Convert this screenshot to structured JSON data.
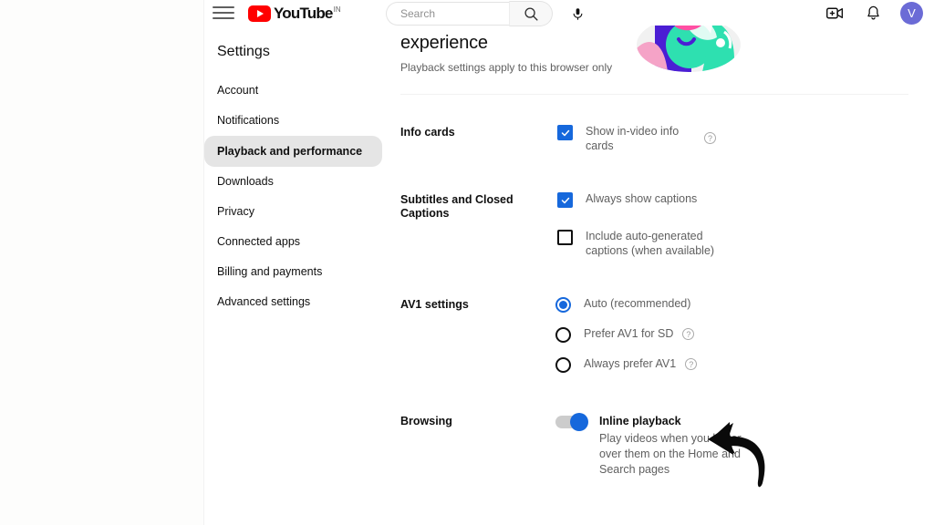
{
  "masthead": {
    "menu_icon": "hamburger-icon",
    "logo_text": "YouTube",
    "logo_country": "IN",
    "search_placeholder": "Search",
    "search_value": "",
    "search_icon": "search-icon",
    "mic_icon": "microphone-icon",
    "create_icon": "create-video-icon",
    "notifications_icon": "bell-icon",
    "avatar_letter": "V"
  },
  "sidebar": {
    "title": "Settings",
    "items": [
      {
        "label": "Account",
        "active": false
      },
      {
        "label": "Notifications",
        "active": false
      },
      {
        "label": "Playback and performance",
        "active": true
      },
      {
        "label": "Downloads",
        "active": false
      },
      {
        "label": "Privacy",
        "active": false
      },
      {
        "label": "Connected apps",
        "active": false
      },
      {
        "label": "Billing and payments",
        "active": false
      },
      {
        "label": "Advanced settings",
        "active": false
      }
    ]
  },
  "main": {
    "title": "experience",
    "subtitle": "Playback settings apply to this browser only",
    "sections": {
      "info_cards": {
        "label": "Info cards",
        "option_label": "Show in-video info cards",
        "checked": true,
        "help_icon": "help-circle-icon"
      },
      "subtitles": {
        "label": "Subtitles and Closed Captions",
        "option1_label": "Always show captions",
        "option1_checked": true,
        "option2_label": "Include auto-generated captions (when available)",
        "option2_checked": false
      },
      "av1": {
        "label": "AV1 settings",
        "options": [
          {
            "label": "Auto (recommended)",
            "selected": true,
            "help": false
          },
          {
            "label": "Prefer AV1 for SD",
            "selected": false,
            "help": true
          },
          {
            "label": "Always prefer AV1",
            "selected": false,
            "help": true
          }
        ]
      },
      "browsing": {
        "label": "Browsing",
        "toggle_label": "Inline playback",
        "toggle_on": true,
        "toggle_description": "Play videos when you hover over them on the Home and Search pages"
      }
    }
  },
  "annotation": {
    "arrow": "curved-arrow-pointing-to-toggle"
  },
  "colors": {
    "accent_blue": "#1668dc",
    "brand_red": "#ff0000",
    "avatar_purple": "#6b6bd6",
    "text_primary": "#0f0f0f",
    "text_secondary": "#606060",
    "active_nav_bg": "#e5e5e5"
  }
}
